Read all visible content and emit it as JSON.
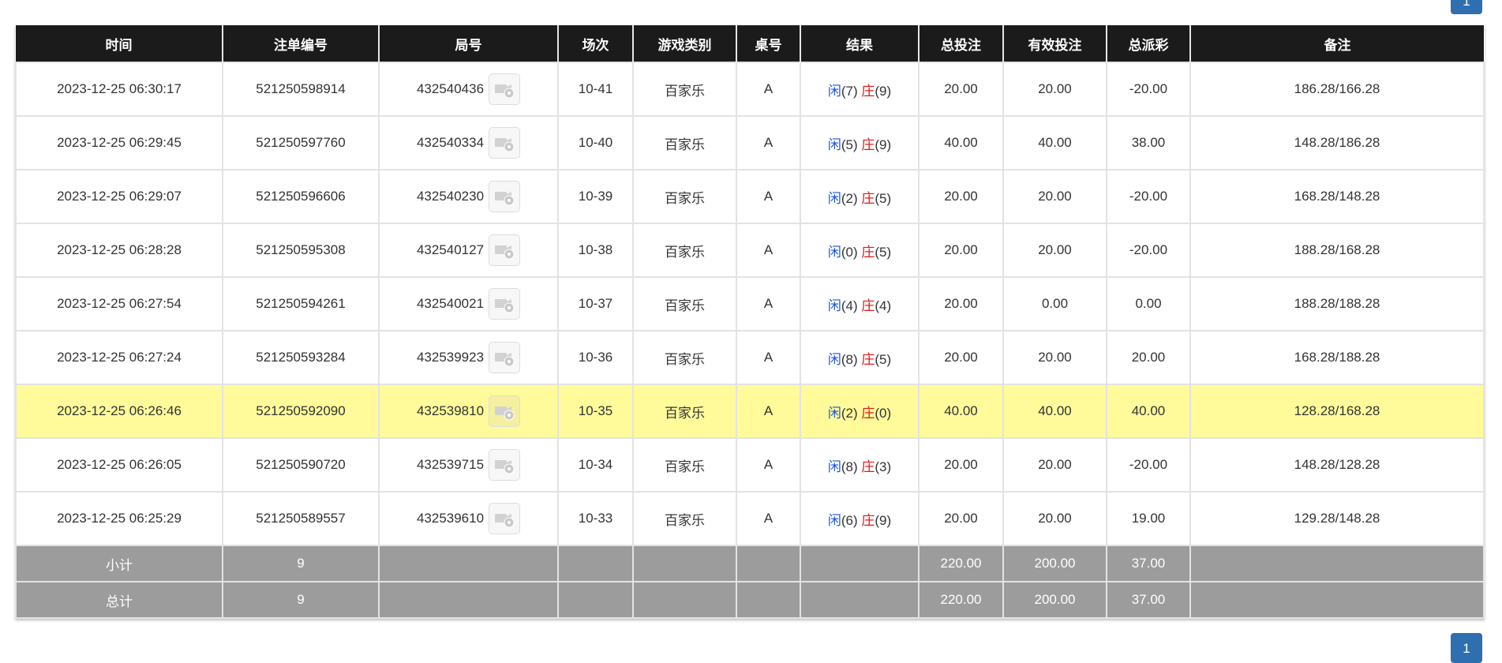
{
  "pagination": {
    "top_page": "1",
    "bottom_page": "1"
  },
  "colors": {
    "header_bg": "#1b1b1b",
    "highlight_row": "#fffb9b",
    "summary_bg": "#9c9c9c",
    "player": "#1a56d6",
    "banker": "#e01818"
  },
  "columns": [
    "时间",
    "注单编号",
    "局号",
    "场次",
    "游戏类别",
    "桌号",
    "结果",
    "总投注",
    "有效投注",
    "总派彩",
    "备注"
  ],
  "labels": {
    "player": "闲",
    "banker": "庄"
  },
  "rows": [
    {
      "time": "2023-12-25 06:30:17",
      "bet_no": "521250598914",
      "round": "432540436",
      "session": "10-41",
      "game": "百家乐",
      "table": "A",
      "player": "(7)",
      "banker": "(9)",
      "total_bet": "20.00",
      "valid_bet": "20.00",
      "payout": "-20.00",
      "payout_neg": true,
      "note": "186.28/166.28"
    },
    {
      "time": "2023-12-25 06:29:45",
      "bet_no": "521250597760",
      "round": "432540334",
      "session": "10-40",
      "game": "百家乐",
      "table": "A",
      "player": "(5)",
      "banker": "(9)",
      "total_bet": "40.00",
      "valid_bet": "40.00",
      "payout": "38.00",
      "payout_neg": false,
      "note": "148.28/186.28"
    },
    {
      "time": "2023-12-25 06:29:07",
      "bet_no": "521250596606",
      "round": "432540230",
      "session": "10-39",
      "game": "百家乐",
      "table": "A",
      "player": "(2)",
      "banker": "(5)",
      "total_bet": "20.00",
      "valid_bet": "20.00",
      "payout": "-20.00",
      "payout_neg": true,
      "note": "168.28/148.28"
    },
    {
      "time": "2023-12-25 06:28:28",
      "bet_no": "521250595308",
      "round": "432540127",
      "session": "10-38",
      "game": "百家乐",
      "table": "A",
      "player": "(0)",
      "banker": "(5)",
      "total_bet": "20.00",
      "valid_bet": "20.00",
      "payout": "-20.00",
      "payout_neg": true,
      "note": "188.28/168.28"
    },
    {
      "time": "2023-12-25 06:27:54",
      "bet_no": "521250594261",
      "round": "432540021",
      "session": "10-37",
      "game": "百家乐",
      "table": "A",
      "player": "(4)",
      "banker": "(4)",
      "total_bet": "20.00",
      "valid_bet": "0.00",
      "payout": "0.00",
      "payout_neg": false,
      "note": "188.28/188.28"
    },
    {
      "time": "2023-12-25 06:27:24",
      "bet_no": "521250593284",
      "round": "432539923",
      "session": "10-36",
      "game": "百家乐",
      "table": "A",
      "player": "(8)",
      "banker": "(5)",
      "total_bet": "20.00",
      "valid_bet": "20.00",
      "payout": "20.00",
      "payout_neg": false,
      "note": "168.28/188.28"
    },
    {
      "time": "2023-12-25 06:26:46",
      "bet_no": "521250592090",
      "round": "432539810",
      "session": "10-35",
      "game": "百家乐",
      "table": "A",
      "player": "(2)",
      "banker": "(0)",
      "total_bet": "40.00",
      "valid_bet": "40.00",
      "payout": "40.00",
      "payout_neg": false,
      "note": "128.28/168.28",
      "highlight": true
    },
    {
      "time": "2023-12-25 06:26:05",
      "bet_no": "521250590720",
      "round": "432539715",
      "session": "10-34",
      "game": "百家乐",
      "table": "A",
      "player": "(8)",
      "banker": "(3)",
      "total_bet": "20.00",
      "valid_bet": "20.00",
      "payout": "-20.00",
      "payout_neg": true,
      "note": "148.28/128.28"
    },
    {
      "time": "2023-12-25 06:25:29",
      "bet_no": "521250589557",
      "round": "432539610",
      "session": "10-33",
      "game": "百家乐",
      "table": "A",
      "player": "(6)",
      "banker": "(9)",
      "total_bet": "20.00",
      "valid_bet": "20.00",
      "payout": "19.00",
      "payout_neg": false,
      "note": "129.28/148.28"
    }
  ],
  "subtotal": {
    "label": "小计",
    "count": "9",
    "total_bet": "220.00",
    "valid_bet": "200.00",
    "payout": "37.00"
  },
  "total": {
    "label": "总计",
    "count": "9",
    "total_bet": "220.00",
    "valid_bet": "200.00",
    "payout": "37.00"
  }
}
